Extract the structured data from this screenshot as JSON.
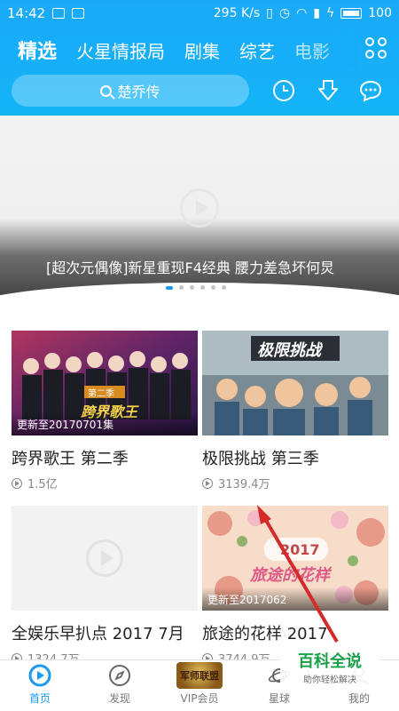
{
  "status_bar": {
    "time": "14:42",
    "speed": "295 K/s",
    "battery": "100"
  },
  "tabs": [
    {
      "label": "精选"
    },
    {
      "label": "火星情报局"
    },
    {
      "label": "剧集"
    },
    {
      "label": "综艺"
    },
    {
      "label": "电影"
    }
  ],
  "search": {
    "placeholder": "楚乔传"
  },
  "banner": {
    "caption": "[超次元偶像]新星重现F4经典 腰力差急坏何炅",
    "slide_count": 6,
    "active_slide": 1
  },
  "cards": [
    {
      "title": "跨界歌王 第二季",
      "plays": "1.5亿",
      "update": "更新至20170701集",
      "poster_text": "跨界歌王",
      "poster_badge": "第二季"
    },
    {
      "title": "极限挑战 第三季",
      "plays": "3139.4万",
      "update": "",
      "poster_text": "极限挑战"
    },
    {
      "title": "全娱乐早扒点 2017 7月",
      "plays": "1324.7万",
      "update": ""
    },
    {
      "title": "旅途的花样 2017",
      "plays": "3744.9万",
      "update": "更新至2017062",
      "poster_text": "旅途的花样",
      "poster_badge": "2017"
    }
  ],
  "bottom_nav": [
    {
      "label": "首页"
    },
    {
      "label": "发现"
    },
    {
      "label": "VIP会员",
      "badge": "军师联盟"
    },
    {
      "label": "星球"
    },
    {
      "label": "我的"
    }
  ],
  "watermark": {
    "title": "百科全说",
    "subtitle": "助你轻松解决"
  },
  "colors": {
    "brand_blue": "#1aa9f8",
    "active_nav": "#1a9bf0"
  }
}
